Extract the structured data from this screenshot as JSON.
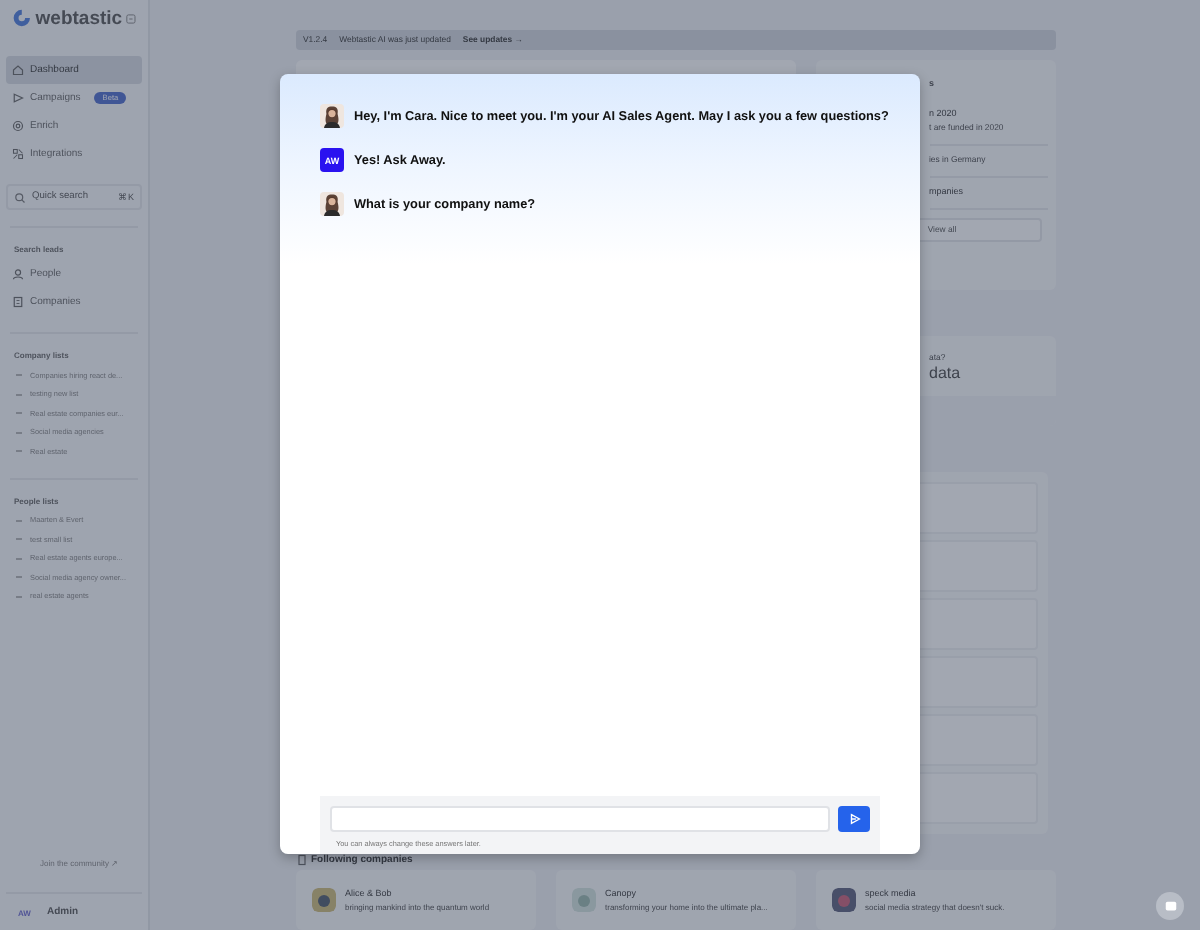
{
  "sidebar": {
    "logo": "webtastic",
    "nav": [
      {
        "label": "Dashboard",
        "selected": true
      },
      {
        "label": "Campaigns",
        "badge": "Beta",
        "selected": false
      },
      {
        "label": "Enrich",
        "selected": false
      },
      {
        "label": "Integrations",
        "selected": false
      }
    ],
    "search": {
      "placeholder": "Quick search",
      "shortcut": "⌘K"
    },
    "search_leads": {
      "title": "Search leads",
      "items": [
        {
          "label": "People"
        },
        {
          "label": "Companies"
        }
      ]
    },
    "company_lists": {
      "title": "Company lists",
      "items": [
        {
          "label": "Companies hiring react de..."
        },
        {
          "label": "testing new list"
        },
        {
          "label": "Real estate companies eur..."
        },
        {
          "label": "Social media agencies"
        },
        {
          "label": "Real estate"
        }
      ]
    },
    "people_lists": {
      "title": "People lists",
      "items": [
        {
          "label": "Maarten & Evert"
        },
        {
          "label": "test small list"
        },
        {
          "label": "Real estate agents europe..."
        },
        {
          "label": "Social media agency owner..."
        },
        {
          "label": "real estate agents"
        }
      ]
    },
    "community": "Join the community ↗",
    "user": {
      "initials": "AW",
      "name": "Admin"
    }
  },
  "update_bar": {
    "version": "V1.2.4",
    "message": "Webtastic AI was just updated",
    "link": "See updates →"
  },
  "right_panel": {
    "heading": "s",
    "items": [
      {
        "title": "n 2020",
        "subtitle": "t are funded in 2020"
      },
      {
        "subtitle": "ies in Germany"
      },
      {
        "title": "mpanies"
      }
    ],
    "button": "View all",
    "data_card": {
      "label": "ata?",
      "value": "data"
    }
  },
  "following": {
    "title": "Following companies",
    "companies": [
      {
        "name": "Alice & Bob",
        "tagline": "bringing mankind into the quantum world"
      },
      {
        "name": "Canopy",
        "tagline": "transforming your home into the ultimate pla..."
      },
      {
        "name": "speck media",
        "tagline": "social media strategy that doesn't suck."
      }
    ]
  },
  "modal": {
    "messages": [
      {
        "kind": "agent",
        "text": "Hey, I'm Cara. Nice to meet you. I'm your AI Sales Agent. May I ask you a few questions?"
      },
      {
        "kind": "user",
        "initials": "AW",
        "text": "Yes! Ask Away."
      },
      {
        "kind": "agent",
        "text": "What is your company name?"
      }
    ],
    "hint": "You can always change these answers later."
  }
}
